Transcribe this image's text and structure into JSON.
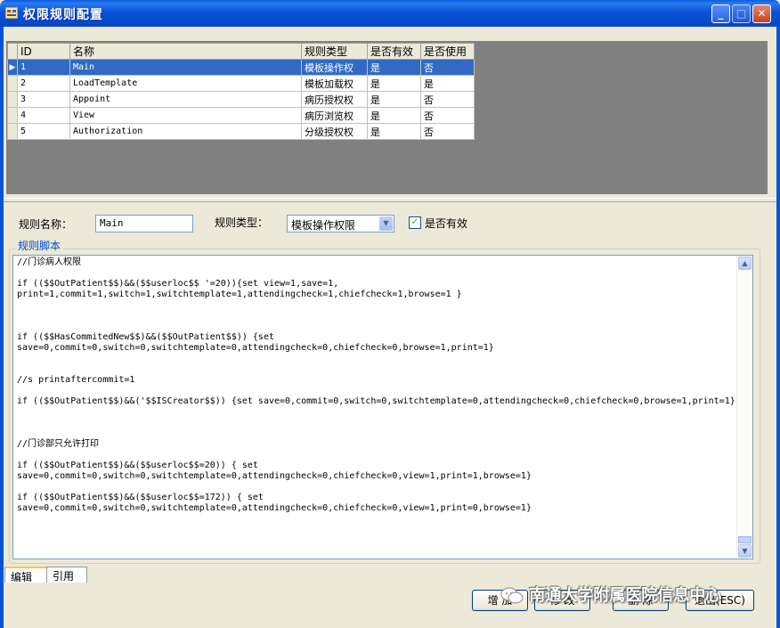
{
  "window": {
    "title": "权限规则配置"
  },
  "grid": {
    "columns": [
      "ID",
      "名称",
      "规则类型",
      "是否有效",
      "是否使用"
    ],
    "rows": [
      {
        "id": "1",
        "name": "Main",
        "type": "模板操作权",
        "valid": "是",
        "used": "否",
        "selected": true
      },
      {
        "id": "2",
        "name": "LoadTemplate",
        "type": "模板加载权",
        "valid": "是",
        "used": "是"
      },
      {
        "id": "3",
        "name": "Appoint",
        "type": "病历授权权",
        "valid": "是",
        "used": "否"
      },
      {
        "id": "4",
        "name": "View",
        "type": "病历浏览权",
        "valid": "是",
        "used": "否"
      },
      {
        "id": "5",
        "name": "Authorization",
        "type": "分级授权权",
        "valid": "是",
        "used": "否"
      }
    ]
  },
  "form": {
    "name_label": "规则名称：",
    "name_value": "Main",
    "type_label": "规则类型：",
    "type_value": "模板操作权限",
    "valid_label": "是否有效",
    "valid_checked": true,
    "script_group_label": "规则脚本",
    "script": "//门诊病人权限\n\nif (($$OutPatient$$)&&($$userloc$$ '=20)){set view=1,save=1,\nprint=1,commit=1,switch=1,switchtemplate=1,attendingcheck=1,chiefcheck=1,browse=1 }\n\n\n\nif (($$HasCommitedNew$$)&&($$OutPatient$$)) {set\nsave=0,commit=0,switch=0,switchtemplate=0,attendingcheck=0,chiefcheck=0,browse=1,print=1}\n\n\n//s printaftercommit=1\n\nif (($$OutPatient$$)&&('$$ISCreator$$)) {set save=0,commit=0,switch=0,switchtemplate=0,attendingcheck=0,chiefcheck=0,browse=1,print=1}\n\n\n\n//门诊部只允许打印\n\nif (($$OutPatient$$)&&($$userloc$$=20)) { set\nsave=0,commit=0,switch=0,switchtemplate=0,attendingcheck=0,chiefcheck=0,view=1,print=1,browse=1}\n\nif (($$OutPatient$$)&&($$userloc$$=172)) { set\nsave=0,commit=0,switch=0,switchtemplate=0,attendingcheck=0,chiefcheck=0,view=1,print=0,browse=1}"
  },
  "tabs": [
    "编辑",
    "引用"
  ],
  "buttons": {
    "add": "增 加",
    "modify": "修 改",
    "delete": "删 除",
    "exit": "退出(ESC)"
  },
  "watermark": "南通大学附属医院信息中心",
  "colors": {
    "titlebar": "#0a53d8",
    "selection": "#316ac5",
    "group_title": "#0046d5"
  }
}
